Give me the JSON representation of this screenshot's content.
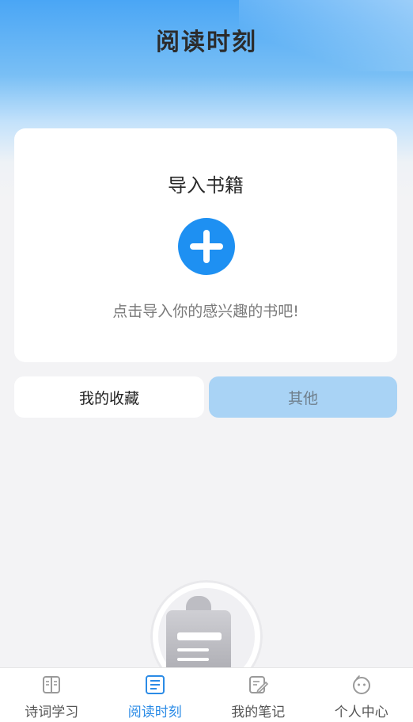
{
  "header": {
    "title": "阅读时刻"
  },
  "import_card": {
    "title": "导入书籍",
    "add_icon": "plus-icon",
    "hint": "点击导入你的感兴趣的书吧!"
  },
  "tabs": [
    {
      "label": "我的收藏",
      "selected": false
    },
    {
      "label": "其他",
      "selected": true
    }
  ],
  "empty_state": {
    "icon": "clipboard-illustration"
  },
  "bottom_nav": {
    "active_color": "#2b8be6",
    "items": [
      {
        "label": "诗词学习",
        "icon": "book-icon",
        "active": false
      },
      {
        "label": "阅读时刻",
        "icon": "document-icon",
        "active": true
      },
      {
        "label": "我的笔记",
        "icon": "note-edit-icon",
        "active": false
      },
      {
        "label": "个人中心",
        "icon": "face-icon",
        "active": false
      }
    ]
  }
}
